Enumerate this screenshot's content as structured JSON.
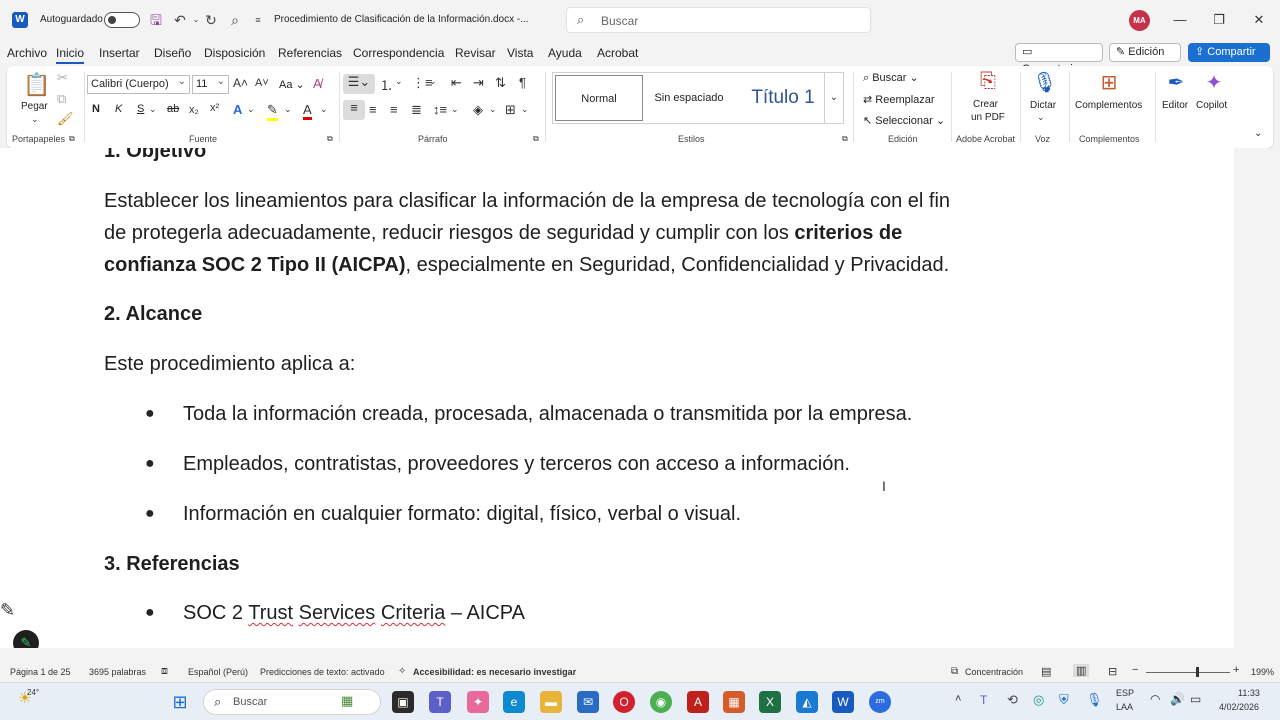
{
  "titlebar": {
    "autosave_label": "Autoguardado",
    "document_title": "Procedimiento de Clasificación de la Información.docx  -...",
    "search_placeholder": "Buscar",
    "user_initials": "MA"
  },
  "menu": {
    "tabs": [
      "Archivo",
      "Inicio",
      "Insertar",
      "Diseño",
      "Disposición",
      "Referencias",
      "Correspondencia",
      "Revisar",
      "Vista",
      "Ayuda",
      "Acrobat"
    ],
    "comments_label": "Comentarios",
    "editing_label": "Edición",
    "share_label": "Compartir"
  },
  "ribbon": {
    "paste_label": "Pegar",
    "font_name": "Calibri (Cuerpo)",
    "font_size": "11",
    "case_label": "Aa",
    "bold": "N",
    "italic": "K",
    "underline": "S",
    "strike": "ab",
    "styles": [
      "Normal",
      "Sin espaciado",
      "Título 1"
    ],
    "find_label": "Buscar",
    "replace_label": "Reemplazar",
    "select_label": "Seleccionar",
    "create_pdf_line1": "Crear",
    "create_pdf_line2": "un PDF",
    "dictate_label": "Dictar",
    "addins_label": "Complementos",
    "editor_label": "Editor",
    "copilot_label": "Copilot",
    "groups": {
      "clipboard": "Portapapeles",
      "font": "Fuente",
      "paragraph": "Párrafo",
      "styles": "Estilos",
      "editing": "Edición",
      "acrobat": "Adobe Acrobat",
      "voice": "Voz",
      "addins": "Complementos"
    }
  },
  "document": {
    "heading1": "1. Objetivo",
    "para1_line1": "Establecer los lineamientos para clasificar la información de la empresa de tecnología con el fin",
    "para1_line2_a": "de protegerla adecuadamente, reducir riesgos de seguridad y cumplir con los ",
    "para1_line2_b": "criterios de",
    "para1_line3_a": "confianza SOC 2 Tipo II (AICPA)",
    "para1_line3_b": ", especialmente en Seguridad, Confidencialidad y Privacidad.",
    "heading2": "2. Alcance",
    "para2": "Este procedimiento aplica a:",
    "bullets": [
      "Toda la información creada, procesada, almacenada o transmitida por la empresa.",
      "Empleados, contratistas, proveedores y terceros con acceso a información.",
      "Información en cualquier formato: digital, físico, verbal o visual."
    ],
    "heading3": "3. Referencias",
    "ref_a": "SOC 2 ",
    "ref_b": "Trust",
    "ref_c": " ",
    "ref_d": "Services",
    "ref_e": " ",
    "ref_f": "Criteria",
    "ref_g": " – AICPA"
  },
  "status": {
    "page": "Página 1 de 25",
    "words": "3695 palabras",
    "language": "Español (Perú)",
    "predictions": "Predicciones de texto: activado",
    "accessibility": "Accesibilidad: es necesario investigar",
    "focus": "Concentración",
    "zoom": "199%"
  },
  "taskbar": {
    "weather": "24°",
    "search_placeholder": "Buscar",
    "lang_line1": "ESP",
    "lang_line2": "LAA",
    "time": "11:33",
    "date": "4/02/2026"
  },
  "colors": {
    "accent": "#185abd",
    "share": "#1a6fd0",
    "title_style": "#2f5496"
  }
}
